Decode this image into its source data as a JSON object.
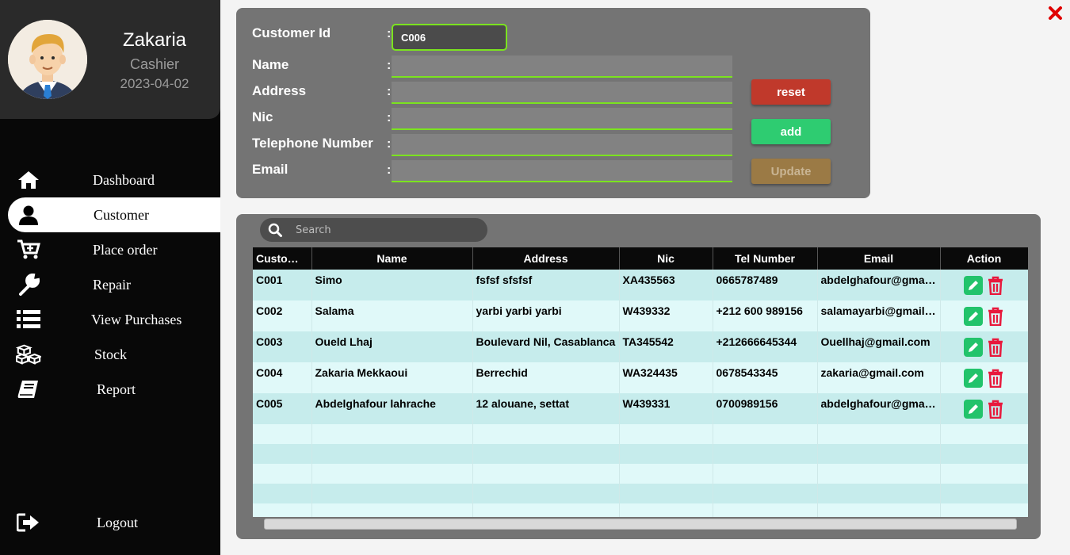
{
  "profile": {
    "name": "Zakaria",
    "role": "Cashier",
    "date": "2023-04-02"
  },
  "nav": [
    {
      "label": "Dashboard",
      "icon": "home-icon",
      "active": false
    },
    {
      "label": "Customer",
      "icon": "user-icon",
      "active": true
    },
    {
      "label": "Place order",
      "icon": "cart-plus-icon",
      "active": false
    },
    {
      "label": "Repair",
      "icon": "wrench-icon",
      "active": false
    },
    {
      "label": "View Purchases",
      "icon": "list-icon",
      "active": false
    },
    {
      "label": "Stock",
      "icon": "cubes-icon",
      "active": false
    },
    {
      "label": "Report",
      "icon": "book-icon",
      "active": false
    }
  ],
  "logout_label": "Logout",
  "form": {
    "customer_id_label": "Customer Id",
    "customer_id_value": "C006",
    "name_label": "Name",
    "address_label": "Address",
    "nic_label": "Nic",
    "telephone_label": "Telephone Number",
    "email_label": "Email",
    "colon": ":",
    "name_value": "",
    "address_value": "",
    "nic_value": "",
    "telephone_value": "",
    "email_value": "",
    "reset_label": "reset",
    "add_label": "add",
    "update_label": "Update"
  },
  "search": {
    "placeholder": "Search"
  },
  "table": {
    "headers": [
      "Customer Id",
      "Name",
      "Address",
      "Nic",
      "Tel Number",
      "Email",
      "Action"
    ],
    "rows": [
      {
        "id": "C001",
        "name": "Simo",
        "address": "fsfsf sfsfsf",
        "nic": "XA435563",
        "tel": "0665787489",
        "email": "abdelghafour@gmail.com"
      },
      {
        "id": "C002",
        "name": "Salama",
        "address": "yarbi yarbi yarbi",
        "nic": "W439332",
        "tel": "+212 600 989156",
        "email": "salamayarbi@gmail.com"
      },
      {
        "id": "C003",
        "name": "Oueld Lhaj",
        "address": "Boulevard Nil, Casablanca",
        "nic": "TA345542",
        "tel": "+212666645344",
        "email": "Ouellhaj@gmail.com"
      },
      {
        "id": "C004",
        "name": "Zakaria Mekkaoui",
        "address": "Berrechid",
        "nic": "WA324435",
        "tel": "0678543345",
        "email": "zakaria@gmail.com"
      },
      {
        "id": "C005",
        "name": "Abdelghafour lahrache",
        "address": "12 alouane, settat",
        "nic": "W439331",
        "tel": "0700989156",
        "email": "abdelghafour@gmail.com"
      }
    ]
  },
  "colors": {
    "accent_green": "#7be31f",
    "reset": "#c0392b",
    "add": "#2ecc71",
    "update": "#9b7a45",
    "delete": "#e8193c"
  }
}
